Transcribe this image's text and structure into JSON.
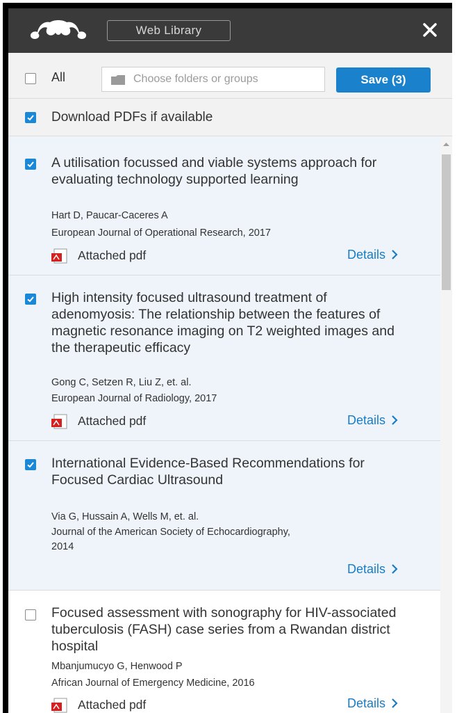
{
  "header": {
    "library_button": "Web Library",
    "logo_icon": "mendeley-logo-icon",
    "close_icon": "close-icon"
  },
  "toolbar": {
    "all_label": "All",
    "all_checked": false,
    "folder_placeholder": "Choose folders or groups",
    "save_label": "Save (3)"
  },
  "download": {
    "label": "Download PDFs if available",
    "checked": true
  },
  "colors": {
    "accent": "#1a82cc",
    "header_bg": "#3a3a3a",
    "selected_bg": "#eef4f9"
  },
  "items": [
    {
      "checked": true,
      "title": "A utilisation focussed and viable systems approach for evaluating technology supported learning",
      "authors": "Hart D,  Paucar-Caceres A",
      "journal": "European Journal of Operational Research, 2017",
      "pdf": "Attached pdf",
      "details": "Details"
    },
    {
      "checked": true,
      "title": "High intensity focused ultrasound treatment of adenomyosis: The relationship between the features of magnetic resonance imaging on T2 weighted images and the therapeutic efficacy",
      "authors": "Gong C,  Setzen R,  Liu Z,  et. al.",
      "journal": "European Journal of Radiology, 2017",
      "pdf": "Attached pdf",
      "details": "Details"
    },
    {
      "checked": true,
      "title": "International Evidence-Based Recommendations for Focused Cardiac Ultrasound",
      "authors": "Via G,  Hussain A,  Wells M,  et. al.",
      "journal": "Journal of the American Society of Echocardiography, 2014",
      "pdf": "",
      "details": "Details"
    },
    {
      "checked": false,
      "title": "Focused assessment with sonography for HIV-associated tuberculosis (FASH) case series from a Rwandan district hospital",
      "authors": "Mbanjumucyo G,  Henwood P",
      "journal": "African Journal of Emergency Medicine, 2016",
      "pdf": "Attached pdf",
      "details": "Details"
    }
  ]
}
